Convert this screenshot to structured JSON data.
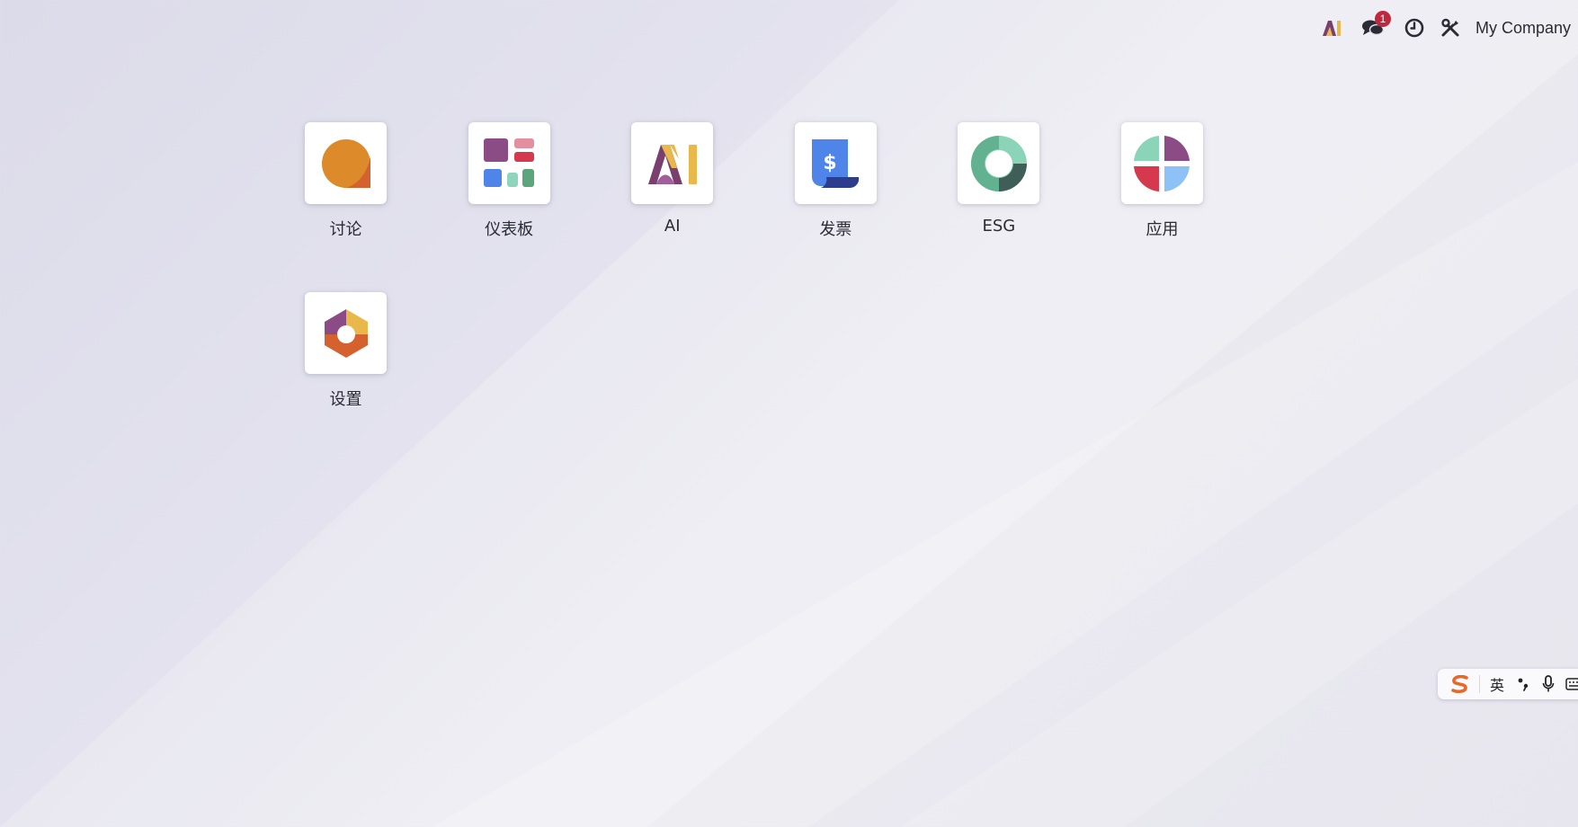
{
  "topbar": {
    "ai_icon": "ai-logo-icon",
    "chat_icon": "chat-bubbles-icon",
    "chat_badge": "1",
    "clock_icon": "clock-icon",
    "tools_icon": "tools-icon",
    "company": "My Company"
  },
  "apps": [
    {
      "label": "讨论",
      "icon": "discuss-icon"
    },
    {
      "label": "仪表板",
      "icon": "dashboard-icon"
    },
    {
      "label": "AI",
      "icon": "ai-icon"
    },
    {
      "label": "发票",
      "icon": "invoice-icon"
    },
    {
      "label": "ESG",
      "icon": "esg-icon"
    },
    {
      "label": "应用",
      "icon": "apps-icon"
    },
    {
      "label": "设置",
      "icon": "settings-icon"
    }
  ],
  "ime": {
    "logo_icon": "sogou-logo-icon",
    "language": "英",
    "punct_icon": "punctuation-icon",
    "mic_icon": "microphone-icon",
    "keyboard_icon": "keyboard-icon"
  },
  "colors": {
    "badge": "#c0283d",
    "text": "#2b2b35"
  }
}
